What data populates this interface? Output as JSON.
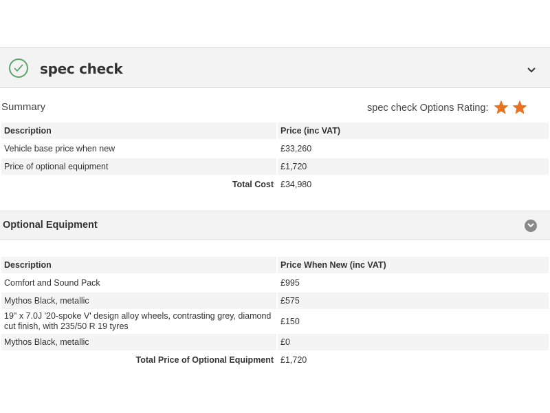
{
  "spec_check": {
    "title": "spec check",
    "summary_label": "Summary",
    "rating_label": "spec check Options Rating:",
    "rating_stars": 2
  },
  "summary_table": {
    "headers": [
      "Description",
      "Price (inc VAT)"
    ],
    "rows": [
      {
        "description": "Vehicle base price when new",
        "price": "£33,260"
      },
      {
        "description": "Price of optional equipment",
        "price": "£1,720"
      }
    ],
    "total_label": "Total Cost",
    "total_value": "£34,980"
  },
  "optional_equipment": {
    "title": "Optional Equipment",
    "headers": [
      "Description",
      "Price When New (inc VAT)"
    ],
    "rows": [
      {
        "description": "Comfort and Sound Pack",
        "price": "£995"
      },
      {
        "description": "Mythos Black, metallic",
        "price": "£575"
      },
      {
        "description": "19\" x 7.0J '20-spoke V' design alloy wheels, contrasting grey, diamond cut finish, with 235/50 R 19 tyres",
        "price": "£150"
      },
      {
        "description": "Mythos Black, metallic",
        "price": "£0"
      }
    ],
    "total_label": "Total Price of Optional Equipment",
    "total_value": "£1,720"
  },
  "colors": {
    "check_green": "#5aa66a",
    "star_orange": "#e8731e",
    "header_bg": "#f3f3f3",
    "row_bg": "#f4f4f4"
  },
  "icons": [
    "check-circle-icon",
    "chevron-down-icon",
    "star-icon",
    "chevron-circle-down-icon"
  ]
}
